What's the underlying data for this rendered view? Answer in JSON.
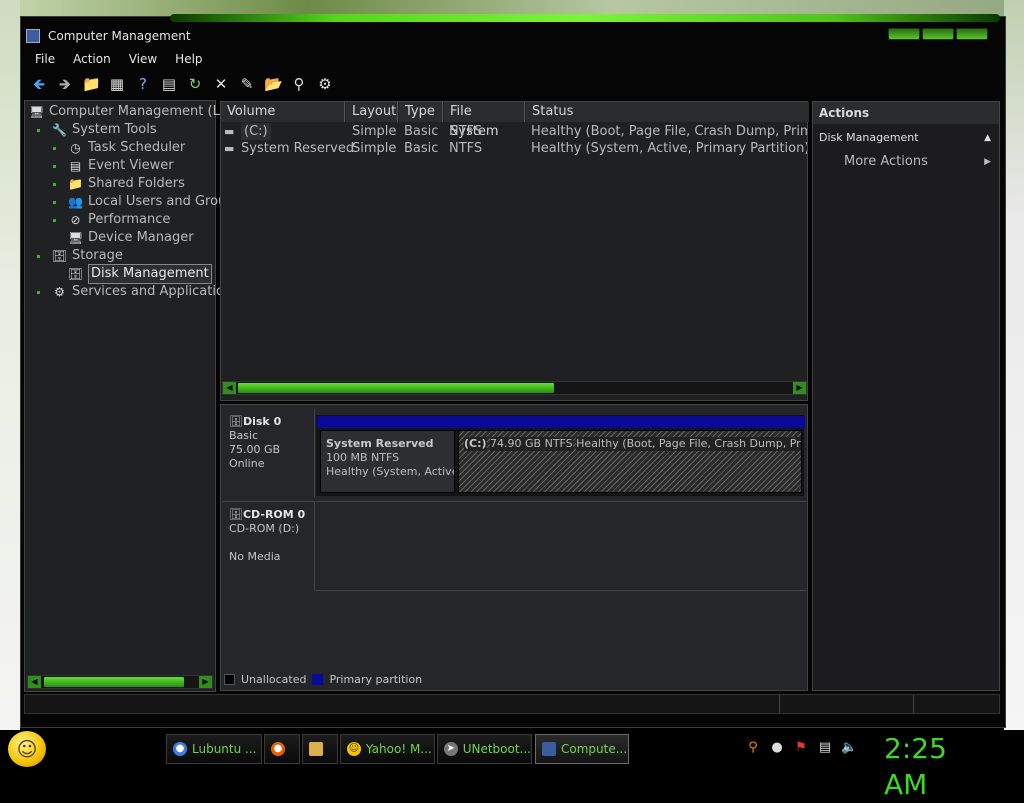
{
  "window": {
    "title": "Computer Management"
  },
  "menu": [
    "File",
    "Action",
    "View",
    "Help"
  ],
  "toolbar_icons": [
    "back-icon",
    "forward-icon",
    "folder-icon",
    "grid-icon",
    "help-icon",
    "properties-icon",
    "refresh-icon",
    "delete-icon",
    "edit-icon",
    "open-icon",
    "search-icon",
    "settings-icon"
  ],
  "tree": {
    "root": "Computer Management (Loc",
    "items": [
      {
        "label": "System Tools",
        "icon": "tools-icon"
      },
      {
        "label": "Task Scheduler",
        "icon": "clock-icon"
      },
      {
        "label": "Event Viewer",
        "icon": "event-viewer-icon"
      },
      {
        "label": "Shared Folders",
        "icon": "shared-folders-icon"
      },
      {
        "label": "Local Users and Grou",
        "icon": "users-icon"
      },
      {
        "label": "Performance",
        "icon": "performance-icon"
      },
      {
        "label": "Device Manager",
        "icon": "device-manager-icon"
      },
      {
        "label": "Storage",
        "icon": "storage-icon"
      },
      {
        "label": "Disk Management",
        "icon": "disk-management-icon"
      },
      {
        "label": "Services and Application",
        "icon": "services-icon"
      }
    ]
  },
  "volumes": {
    "columns": [
      "Volume",
      "Layout",
      "Type",
      "File System",
      "Status"
    ],
    "rows": [
      [
        "(C:)",
        "Simple",
        "Basic",
        "NTFS",
        "Healthy (Boot, Page File, Crash Dump, Primary"
      ],
      [
        "System Reserved",
        "Simple",
        "Basic",
        "NTFS",
        "Healthy (System, Active, Primary Partition)"
      ]
    ]
  },
  "disks": {
    "disk0": {
      "name": "Disk 0",
      "type": "Basic",
      "size": "75.00 GB",
      "state": "Online"
    },
    "partitions": [
      {
        "name": "System Reserved",
        "size": "100 MB NTFS",
        "status": "Healthy (System, Active, P"
      },
      {
        "name": "(C:)",
        "size": "74.90 GB NTFS",
        "status": "Healthy (Boot, Page File, Crash Dump, Primary Partition)"
      }
    ],
    "cdrom": {
      "name": "CD-ROM 0",
      "drive": "CD-ROM (D:)",
      "media": "No Media"
    },
    "legend": [
      "Unallocated",
      "Primary partition"
    ]
  },
  "actions": {
    "header": "Actions",
    "section": "Disk Management",
    "more": "More Actions"
  },
  "taskbar": {
    "buttons": [
      "Lubuntu ...",
      "Yahoo! M...",
      "UNetboot...",
      "Compute..."
    ],
    "clock": "2:25 AM"
  },
  "colors": {
    "accent_green": "#3fd824",
    "primary_partition": "#0a0a9a"
  }
}
